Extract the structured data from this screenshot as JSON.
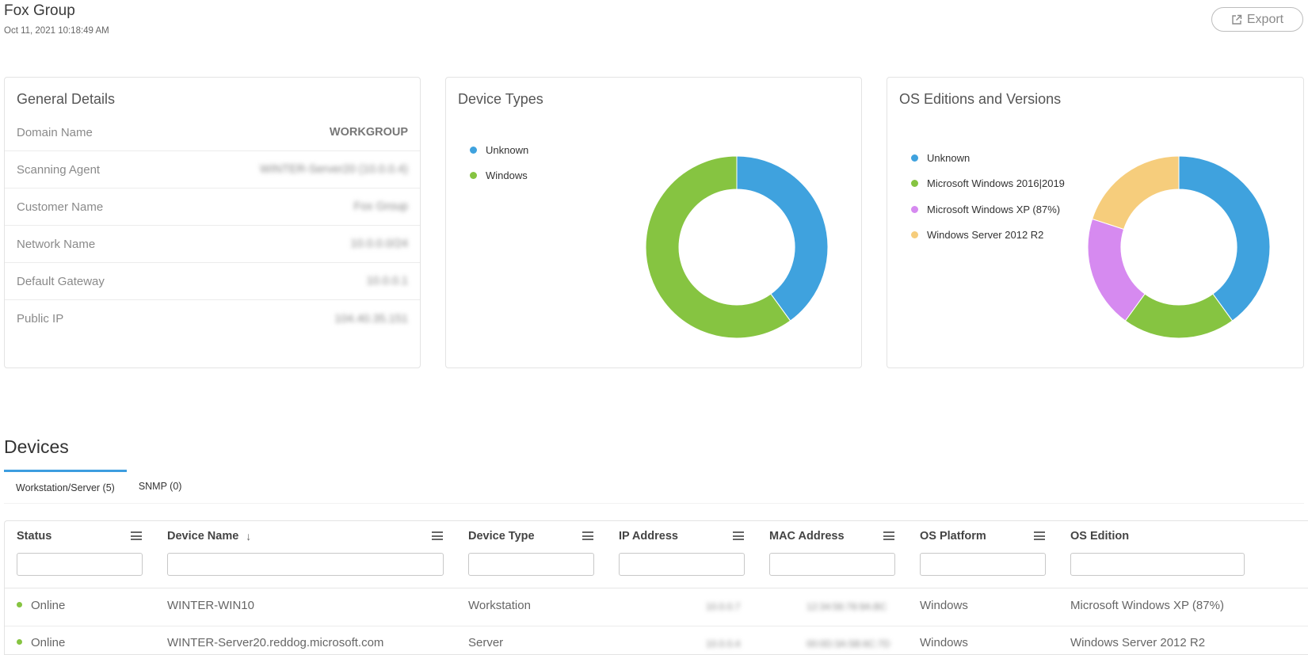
{
  "header": {
    "title": "Fox Group",
    "timestamp": "Oct 11, 2021 10:18:49 AM",
    "export_label": "Export"
  },
  "general_details": {
    "title": "General Details",
    "rows": [
      {
        "label": "Domain Name",
        "value": "WORKGROUP"
      },
      {
        "label": "Scanning Agent",
        "value": "WINTER-Server20 (10.0.0.4)"
      },
      {
        "label": "Customer Name",
        "value": "Fox Group"
      },
      {
        "label": "Network Name",
        "value": "10.0.0.0/24"
      },
      {
        "label": "Default Gateway",
        "value": "10.0.0.1"
      },
      {
        "label": "Public IP",
        "value": "104.40.35.151"
      }
    ]
  },
  "device_types": {
    "title": "Device Types",
    "chart_data": {
      "type": "pie",
      "labels": [
        "Unknown",
        "Windows"
      ],
      "values": [
        2,
        3
      ],
      "colors": [
        "#3fa2de",
        "#86c441"
      ]
    }
  },
  "os_editions": {
    "title": "OS Editions and Versions",
    "chart_data": {
      "type": "pie",
      "labels": [
        "Unknown",
        "Microsoft Windows 2016|2019",
        "Microsoft Windows XP (87%)",
        "Windows Server 2012 R2"
      ],
      "values": [
        2,
        1,
        1,
        1
      ],
      "colors": [
        "#3fa2de",
        "#86c441",
        "#d68af0",
        "#f6cd7c"
      ]
    }
  },
  "devices": {
    "title": "Devices",
    "tabs": [
      {
        "label": "Workstation/Server (5)",
        "active": true
      },
      {
        "label": "SNMP (0)",
        "active": false
      }
    ],
    "columns": [
      "Status",
      "Device Name",
      "Device Type",
      "IP Address",
      "MAC Address",
      "OS Platform",
      "OS Edition"
    ],
    "rows": [
      {
        "status": "Online",
        "status_color": "#86c441",
        "device_name": "WINTER-WIN10",
        "device_type": "Workstation",
        "ip": "10.0.0.7",
        "mac": "12:34:56:78:9A:BC",
        "os_platform": "Windows",
        "os_edition": "Microsoft Windows XP (87%)"
      },
      {
        "status": "Online",
        "status_color": "#86c441",
        "device_name": "WINTER-Server20.reddog.microsoft.com",
        "device_type": "Server",
        "ip": "10.0.0.4",
        "mac": "00:0D:3A:5B:6C:7D",
        "os_platform": "Windows",
        "os_edition": "Windows Server 2012 R2"
      }
    ]
  },
  "icons": {
    "export": "external-link-icon",
    "column_menu": "hamburger-menu-icon",
    "sort": "arrow-down-icon"
  }
}
